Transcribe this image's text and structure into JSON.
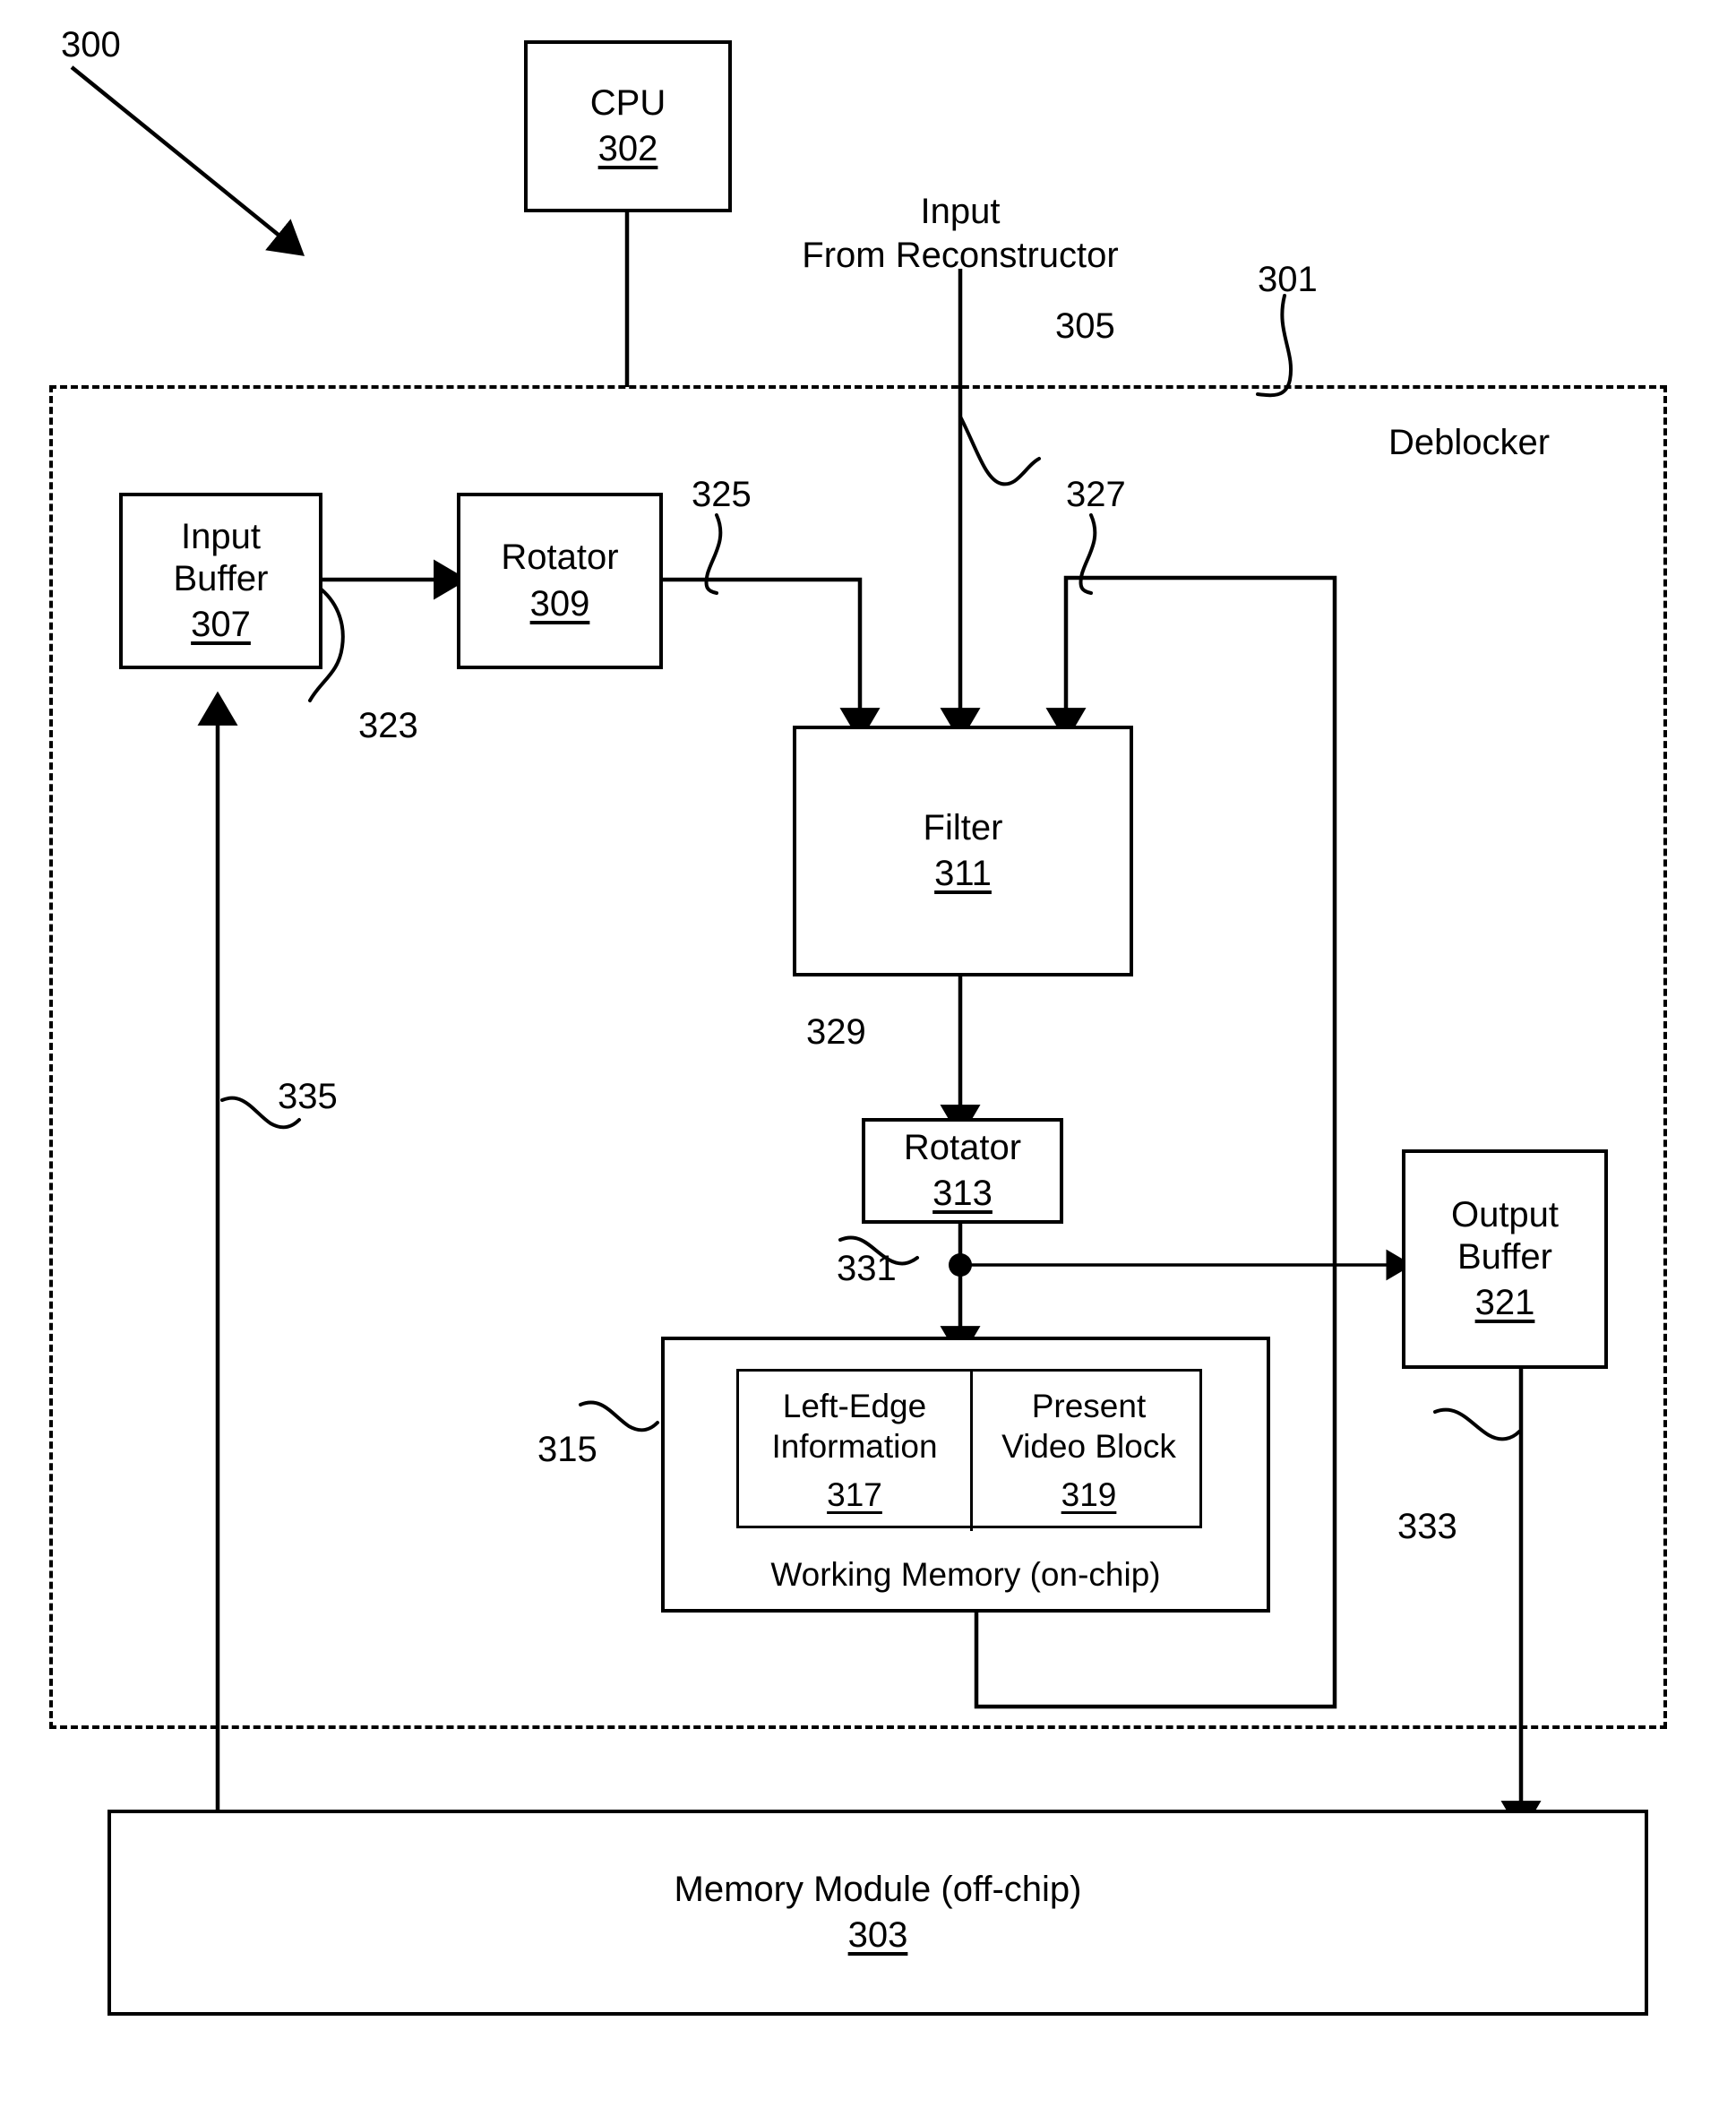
{
  "figure": {
    "figure_ref": "300",
    "enclosure": {
      "label": "Deblocker",
      "ref": "301"
    }
  },
  "blocks": {
    "cpu": {
      "title": "CPU",
      "ref": "302"
    },
    "input_buffer": {
      "title": "Input\nBuffer",
      "ref": "307"
    },
    "rotator_in": {
      "title": "Rotator",
      "ref": "309"
    },
    "filter": {
      "title": "Filter",
      "ref": "311"
    },
    "rotator_out": {
      "title": "Rotator",
      "ref": "313"
    },
    "output_buffer": {
      "title": "Output\nBuffer",
      "ref": "321"
    },
    "working_memory": {
      "title": "Working Memory (on-chip)",
      "ref": "315"
    },
    "left_edge_info": {
      "title": "Left-Edge\nInformation",
      "ref": "317"
    },
    "present_block": {
      "title": "Present\nVideo Block",
      "ref": "319"
    },
    "memory_module": {
      "title": "Memory Module (off-chip)",
      "ref": "303"
    }
  },
  "annotations": {
    "input_source": "Input\nFrom Reconstructor",
    "signal_305": "305",
    "signal_323": "323",
    "signal_325": "325",
    "signal_327": "327",
    "signal_329": "329",
    "signal_331": "331",
    "signal_333": "333",
    "signal_335": "335"
  },
  "style": {
    "line_color": "#000000",
    "background": "#ffffff"
  }
}
